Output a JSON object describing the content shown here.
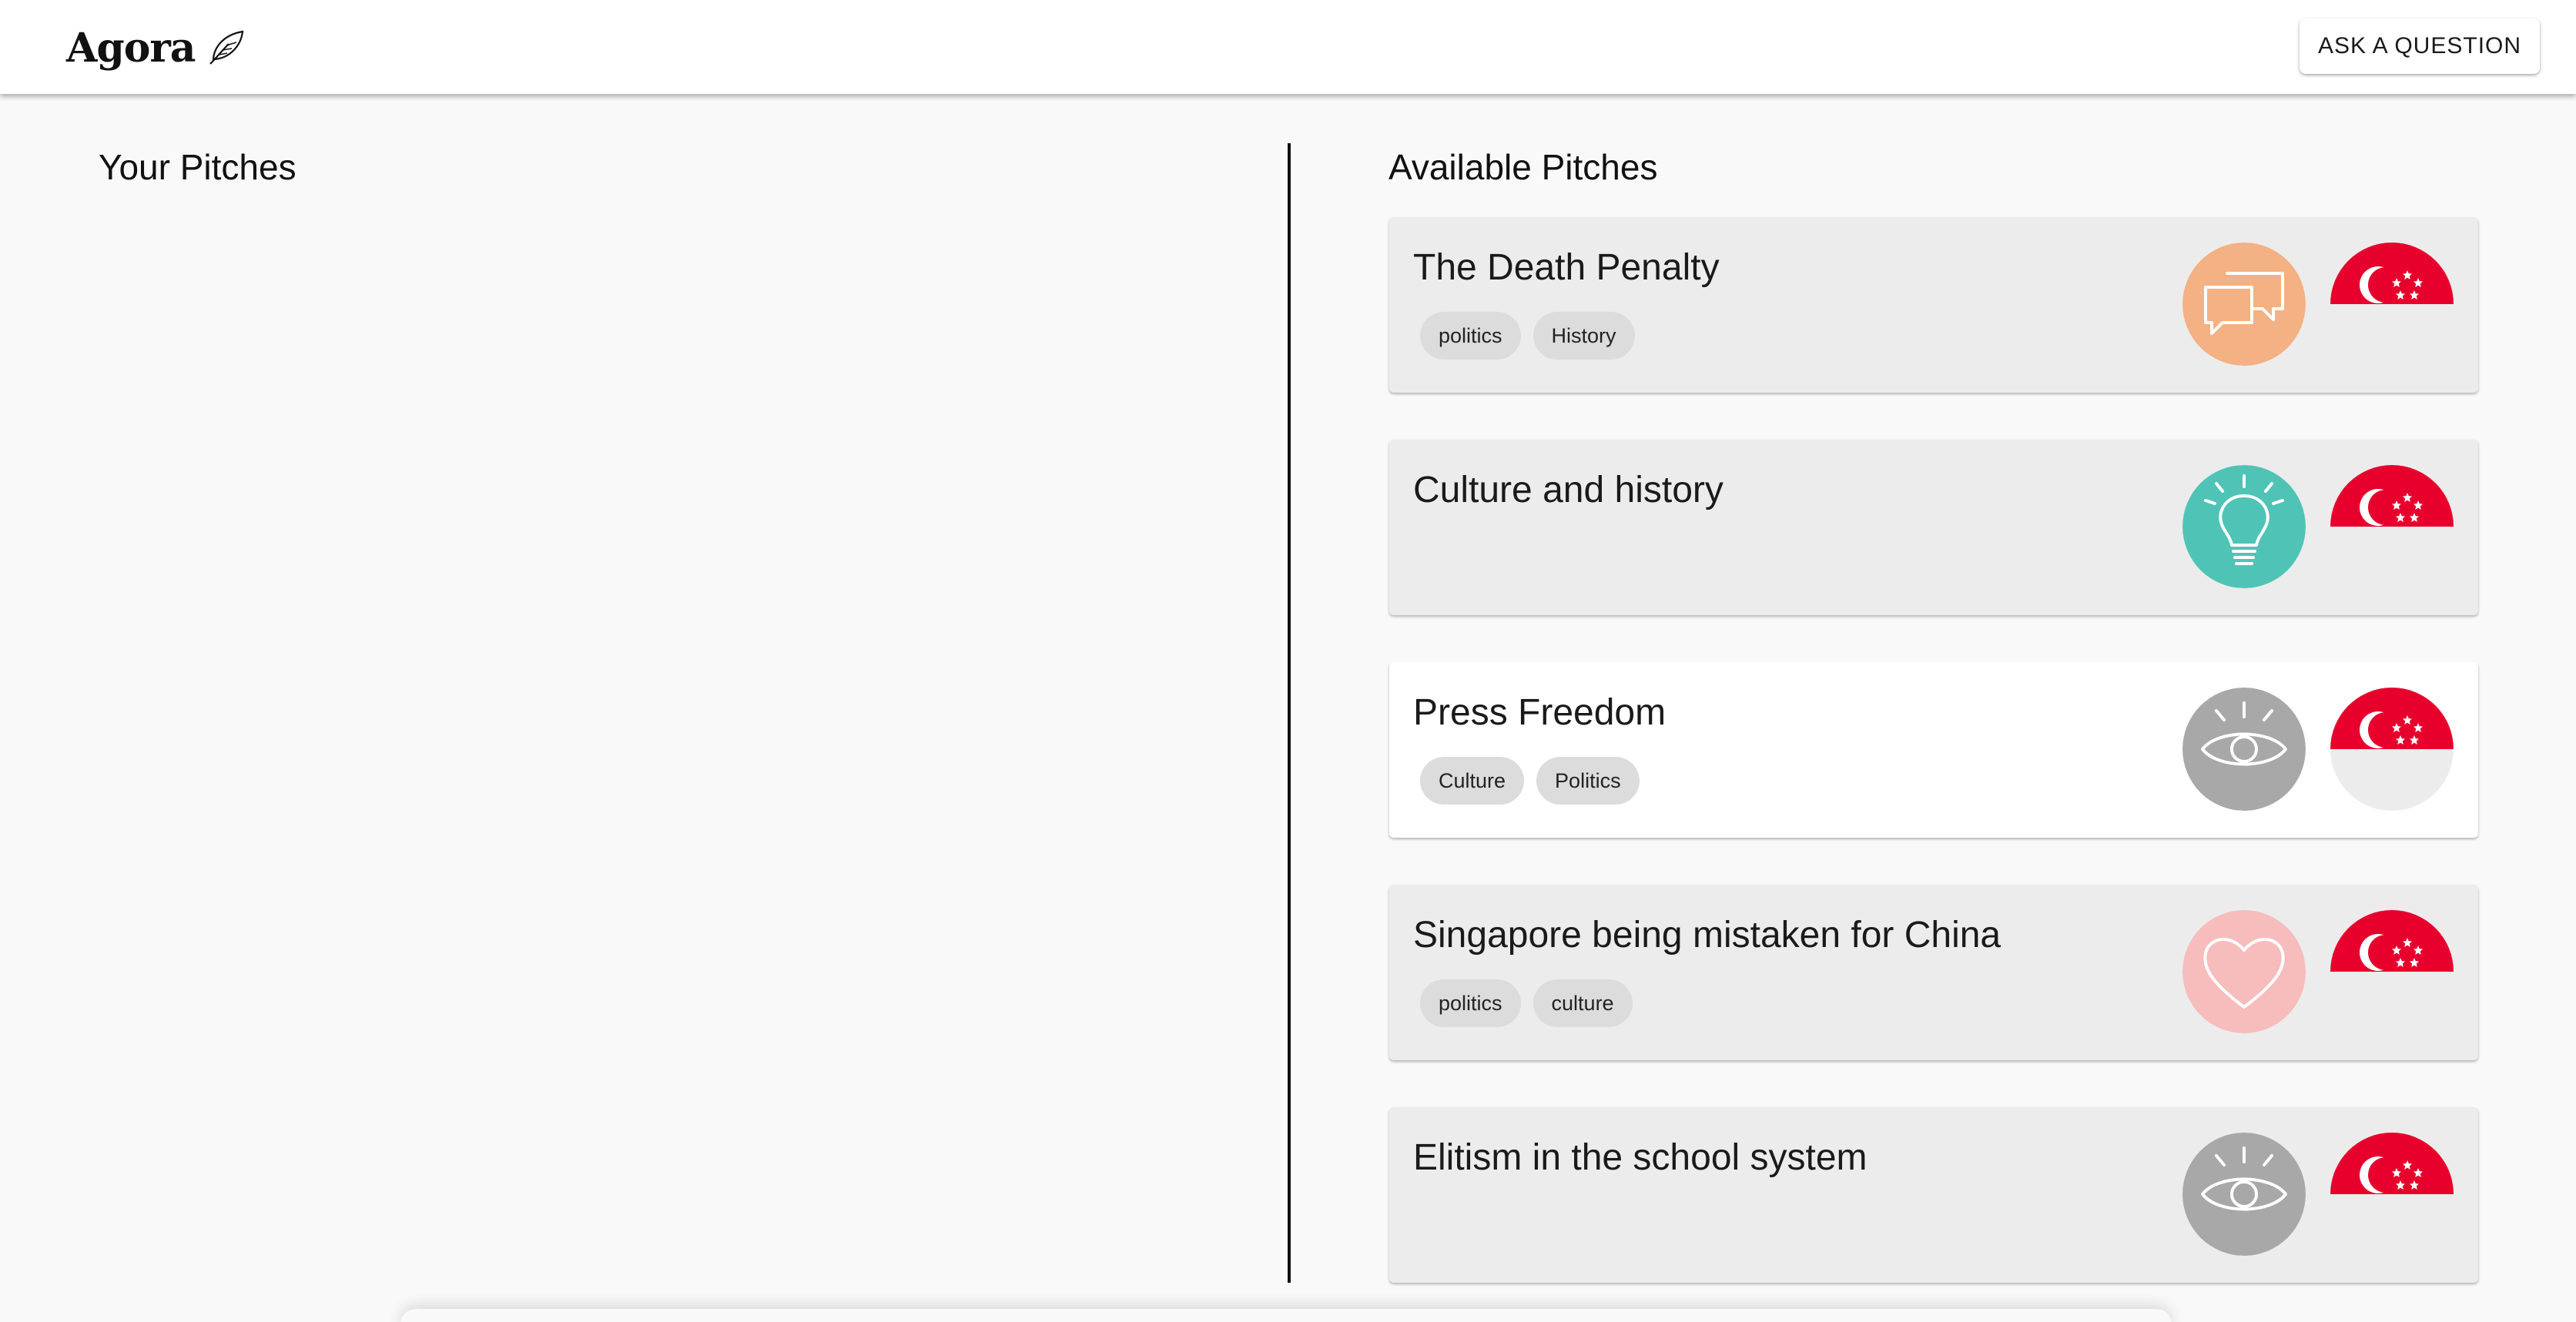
{
  "app": {
    "logo_text": "Agora",
    "logo_icon": "feather-icon",
    "ask_button": "ASK A QUESTION"
  },
  "your_pitches": {
    "title": "Your Pitches"
  },
  "available_pitches": {
    "title": "Available Pitches",
    "items": [
      {
        "title": "The Death Penalty",
        "tags": [
          "politics",
          "History"
        ],
        "type_icon": "speech-bubbles-icon",
        "type_color": "#f4b183",
        "type_label": "Have a discussion",
        "flag": "singapore-flag-icon",
        "selected": false
      },
      {
        "title": "Culture and history",
        "tags": [],
        "type_icon": "lightbulb-icon",
        "type_color": "#4fc4b6",
        "type_label": "Help me understand",
        "flag": "singapore-flag-icon",
        "selected": false
      },
      {
        "title": "Press Freedom",
        "tags": [
          "Culture",
          "Politics"
        ],
        "type_icon": "eye-icon",
        "type_color": "#a8a8a8",
        "type_label": "Share their perspective",
        "flag": "singapore-flag-icon",
        "selected": true
      },
      {
        "title": "Singapore being mistaken for China",
        "tags": [
          "politics",
          "culture"
        ],
        "type_icon": "heart-icon",
        "type_color": "#f7bcbc",
        "type_label": "Share how they feel",
        "flag": "singapore-flag-icon",
        "selected": false
      },
      {
        "title": "Elitism in the school system",
        "tags": [],
        "type_icon": "eye-icon",
        "type_color": "#a8a8a8",
        "type_label": "Share their perspective",
        "flag": "singapore-flag-icon",
        "selected": false
      }
    ]
  },
  "colors": {
    "flag_red": "#e8002d",
    "flag_white": "#ececec",
    "background": "#f9f9f9",
    "card": "#ececec",
    "card_selected": "#ffffff",
    "tag": "#dcdcdc"
  }
}
